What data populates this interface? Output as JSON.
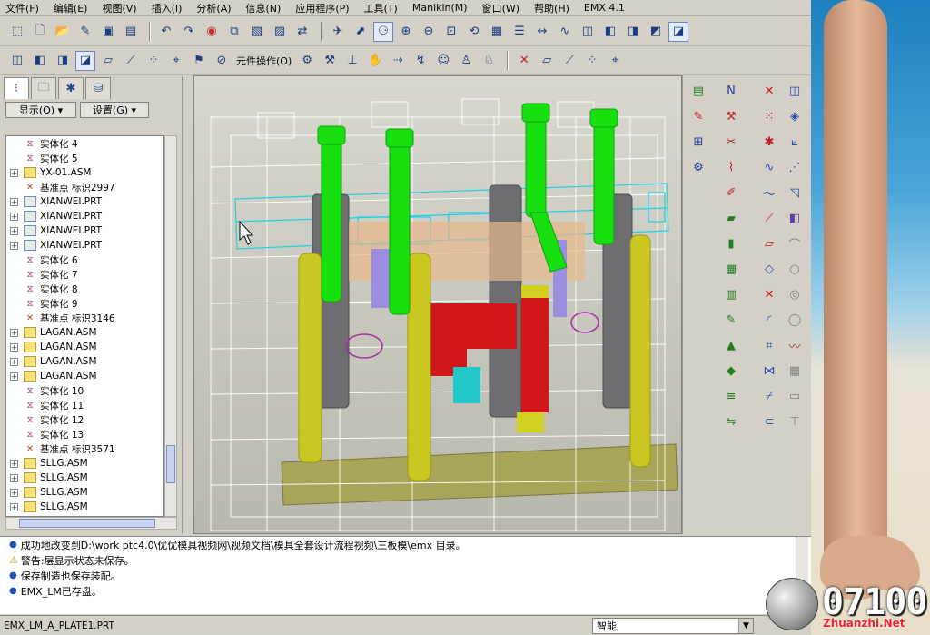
{
  "menu": [
    "文件(F)",
    "编辑(E)",
    "视图(V)",
    "插入(I)",
    "分析(A)",
    "信息(N)",
    "应用程序(P)",
    "工具(T)",
    "Manikin(M)",
    "窗口(W)",
    "帮助(H)",
    "EMX 4.1"
  ],
  "toolbar2": {
    "component_ops_label": "元件操作(O)"
  },
  "panel": {
    "show_button": "显示(O) ▾",
    "settings_button": "设置(G) ▾",
    "tree": [
      {
        "type": "part",
        "label": "实体化 4",
        "expandable": false
      },
      {
        "type": "part",
        "label": "实体化 5",
        "expandable": false
      },
      {
        "type": "asm",
        "label": "YX-01.ASM",
        "expandable": true
      },
      {
        "type": "datum",
        "label": "基准点 标识2997",
        "expandable": false
      },
      {
        "type": "xian",
        "label": "XIANWEI.PRT",
        "expandable": true
      },
      {
        "type": "xian",
        "label": "XIANWEI.PRT",
        "expandable": true
      },
      {
        "type": "xian",
        "label": "XIANWEI.PRT",
        "expandable": true
      },
      {
        "type": "xian",
        "label": "XIANWEI.PRT",
        "expandable": true
      },
      {
        "type": "part",
        "label": "实体化 6",
        "expandable": false
      },
      {
        "type": "part",
        "label": "实体化 7",
        "expandable": false
      },
      {
        "type": "part",
        "label": "实体化 8",
        "expandable": false
      },
      {
        "type": "part",
        "label": "实体化 9",
        "expandable": false
      },
      {
        "type": "datum",
        "label": "基准点 标识3146",
        "expandable": false
      },
      {
        "type": "asm",
        "label": "LAGAN.ASM",
        "expandable": true
      },
      {
        "type": "asm",
        "label": "LAGAN.ASM",
        "expandable": true
      },
      {
        "type": "asm",
        "label": "LAGAN.ASM",
        "expandable": true
      },
      {
        "type": "asm",
        "label": "LAGAN.ASM",
        "expandable": true
      },
      {
        "type": "part",
        "label": "实体化 10",
        "expandable": false
      },
      {
        "type": "part",
        "label": "实体化 11",
        "expandable": false
      },
      {
        "type": "part",
        "label": "实体化 12",
        "expandable": false
      },
      {
        "type": "part",
        "label": "实体化 13",
        "expandable": false
      },
      {
        "type": "datum",
        "label": "基准点 标识3571",
        "expandable": false
      },
      {
        "type": "asm",
        "label": "SLLG.ASM",
        "expandable": true
      },
      {
        "type": "asm",
        "label": "SLLG.ASM",
        "expandable": true
      },
      {
        "type": "asm",
        "label": "SLLG.ASM",
        "expandable": true
      },
      {
        "type": "asm",
        "label": "SLLG.ASM",
        "expandable": true
      }
    ]
  },
  "messages": [
    {
      "kind": "info",
      "text": "成功地改变到D:\\work ptc4.0\\优优模具视频网\\视频文档\\模具全套设计流程视频\\三板模\\emx 目录。"
    },
    {
      "kind": "warn",
      "text": "警告:层显示状态未保存。"
    },
    {
      "kind": "info",
      "text": "保存制造也保存装配。"
    },
    {
      "kind": "info",
      "text": "EMX_LM已存盘。"
    }
  ],
  "status": {
    "file": "EMX_LM_A_PLATE1.PRT",
    "filter_value": "智能"
  },
  "watermark": {
    "number": "07100",
    "site": "Zhuanzhi.Net"
  }
}
